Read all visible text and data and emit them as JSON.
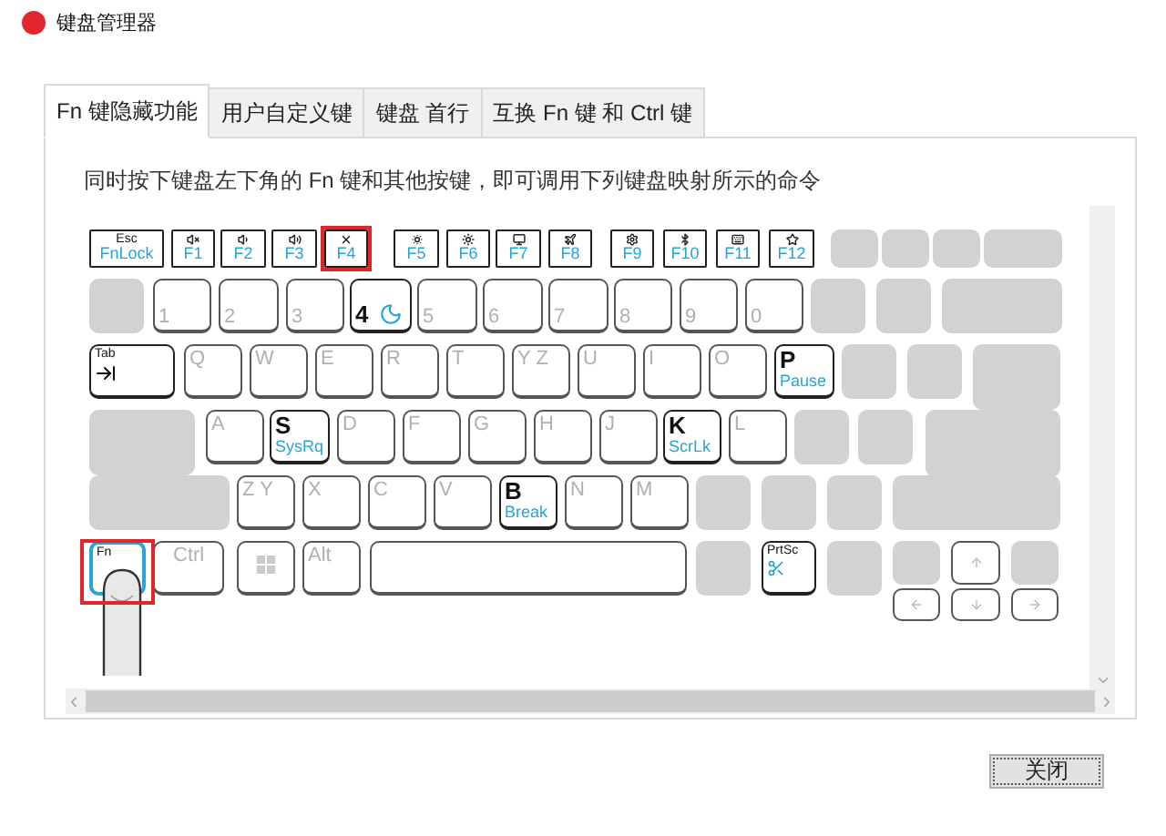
{
  "window": {
    "title": "键盘管理器"
  },
  "tabs": [
    {
      "label": "Fn 键隐藏功能",
      "selected": true
    },
    {
      "label": "用户自定义键",
      "selected": false
    },
    {
      "label": "键盘 首行",
      "selected": false
    },
    {
      "label": "互换 Fn 键 和 Ctrl 键",
      "selected": false
    }
  ],
  "instruction": "同时按下键盘左下角的 Fn 键和其他按键，即可调用下列键盘映射所示的命令",
  "keyboard": {
    "rows": [
      {
        "keys": [
          {
            "kind": "fkey",
            "label": "Esc",
            "function": "FnLock",
            "active": true,
            "highlighted": false,
            "pressed": false
          },
          {
            "kind": "fkey",
            "function": "F1",
            "active": true,
            "highlighted": false,
            "pressed": false
          },
          {
            "kind": "fkey",
            "function": "F2",
            "active": true,
            "highlighted": false,
            "pressed": false
          },
          {
            "kind": "fkey",
            "function": "F3",
            "active": true,
            "highlighted": false,
            "pressed": false
          },
          {
            "kind": "fkey",
            "function": "F4",
            "active": true,
            "highlighted": true,
            "pressed": false
          },
          {
            "kind": "fkey",
            "function": "F5",
            "active": true,
            "highlighted": false,
            "pressed": false
          },
          {
            "kind": "fkey",
            "function": "F6",
            "active": true,
            "highlighted": false,
            "pressed": false
          },
          {
            "kind": "fkey",
            "function": "F7",
            "active": true,
            "highlighted": false,
            "pressed": false
          },
          {
            "kind": "fkey",
            "function": "F8",
            "active": true,
            "highlighted": false,
            "pressed": false
          },
          {
            "kind": "fkey",
            "function": "F9",
            "active": true,
            "highlighted": false,
            "pressed": false
          },
          {
            "kind": "fkey",
            "function": "F10",
            "active": true,
            "highlighted": false,
            "pressed": false
          },
          {
            "kind": "fkey",
            "function": "F11",
            "active": true,
            "highlighted": false,
            "pressed": false
          },
          {
            "kind": "fkey",
            "function": "F12",
            "active": true,
            "highlighted": false,
            "pressed": false
          },
          {
            "kind": "blank"
          },
          {
            "kind": "blank"
          },
          {
            "kind": "blank"
          },
          {
            "kind": "blank"
          }
        ]
      },
      {
        "keys": [
          {
            "kind": "blank"
          },
          {
            "kind": "key",
            "label": "1",
            "active": false,
            "highlighted": false,
            "pressed": false
          },
          {
            "kind": "key",
            "label": "2",
            "active": false,
            "highlighted": false,
            "pressed": false
          },
          {
            "kind": "key",
            "label": "3",
            "active": false,
            "highlighted": false,
            "pressed": false
          },
          {
            "kind": "key",
            "label": "4",
            "active": true,
            "highlighted": false,
            "pressed": false
          },
          {
            "kind": "key",
            "label": "5",
            "active": false,
            "highlighted": false,
            "pressed": false
          },
          {
            "kind": "key",
            "label": "6",
            "active": false,
            "highlighted": false,
            "pressed": false
          },
          {
            "kind": "key",
            "label": "7",
            "active": false,
            "highlighted": false,
            "pressed": false
          },
          {
            "kind": "key",
            "label": "8",
            "active": false,
            "highlighted": false,
            "pressed": false
          },
          {
            "kind": "key",
            "label": "9",
            "active": false,
            "highlighted": false,
            "pressed": false
          },
          {
            "kind": "key",
            "label": "0",
            "active": false,
            "highlighted": false,
            "pressed": false
          },
          {
            "kind": "blank"
          },
          {
            "kind": "blank"
          },
          {
            "kind": "blank"
          }
        ]
      },
      {
        "keys": [
          {
            "kind": "key",
            "label": "Tab",
            "active": true,
            "highlighted": false,
            "pressed": false
          },
          {
            "kind": "key",
            "label": "Q",
            "active": false,
            "highlighted": false,
            "pressed": false
          },
          {
            "kind": "key",
            "label": "W",
            "active": false,
            "highlighted": false,
            "pressed": false
          },
          {
            "kind": "key",
            "label": "E",
            "active": false,
            "highlighted": false,
            "pressed": false
          },
          {
            "kind": "key",
            "label": "R",
            "active": false,
            "highlighted": false,
            "pressed": false
          },
          {
            "kind": "key",
            "label": "T",
            "active": false,
            "highlighted": false,
            "pressed": false
          },
          {
            "kind": "key",
            "label": "Y Z",
            "active": false,
            "highlighted": false,
            "pressed": false
          },
          {
            "kind": "key",
            "label": "U",
            "active": false,
            "highlighted": false,
            "pressed": false
          },
          {
            "kind": "key",
            "label": "I",
            "active": false,
            "highlighted": false,
            "pressed": false
          },
          {
            "kind": "key",
            "label": "O",
            "active": false,
            "highlighted": false,
            "pressed": false
          },
          {
            "kind": "key",
            "label": "P",
            "function": "Pause",
            "active": true,
            "highlighted": false,
            "pressed": false
          },
          {
            "kind": "blank"
          },
          {
            "kind": "blank"
          },
          {
            "kind": "blank"
          }
        ]
      },
      {
        "keys": [
          {
            "kind": "blank"
          },
          {
            "kind": "key",
            "label": "A",
            "active": false,
            "highlighted": false,
            "pressed": false
          },
          {
            "kind": "key",
            "label": "S",
            "function": "SysRq",
            "active": true,
            "highlighted": false,
            "pressed": false
          },
          {
            "kind": "key",
            "label": "D",
            "active": false,
            "highlighted": false,
            "pressed": false
          },
          {
            "kind": "key",
            "label": "F",
            "active": false,
            "highlighted": false,
            "pressed": false
          },
          {
            "kind": "key",
            "label": "G",
            "active": false,
            "highlighted": false,
            "pressed": false
          },
          {
            "kind": "key",
            "label": "H",
            "active": false,
            "highlighted": false,
            "pressed": false
          },
          {
            "kind": "key",
            "label": "J",
            "active": false,
            "highlighted": false,
            "pressed": false
          },
          {
            "kind": "key",
            "label": "K",
            "function": "ScrLk",
            "active": true,
            "highlighted": false,
            "pressed": false
          },
          {
            "kind": "key",
            "label": "L",
            "active": false,
            "highlighted": false,
            "pressed": false
          },
          {
            "kind": "blank"
          },
          {
            "kind": "blank"
          },
          {
            "kind": "blank"
          }
        ]
      },
      {
        "keys": [
          {
            "kind": "blank"
          },
          {
            "kind": "key",
            "label": "Z Y",
            "active": false,
            "highlighted": false,
            "pressed": false
          },
          {
            "kind": "key",
            "label": "X",
            "active": false,
            "highlighted": false,
            "pressed": false
          },
          {
            "kind": "key",
            "label": "C",
            "active": false,
            "highlighted": false,
            "pressed": false
          },
          {
            "kind": "key",
            "label": "V",
            "active": false,
            "highlighted": false,
            "pressed": false
          },
          {
            "kind": "key",
            "label": "B",
            "function": "Break",
            "active": true,
            "highlighted": false,
            "pressed": false
          },
          {
            "kind": "key",
            "label": "N",
            "active": false,
            "highlighted": false,
            "pressed": false
          },
          {
            "kind": "key",
            "label": "M",
            "active": false,
            "highlighted": false,
            "pressed": false
          },
          {
            "kind": "blank"
          },
          {
            "kind": "blank"
          },
          {
            "kind": "blank"
          },
          {
            "kind": "blank"
          }
        ]
      },
      {
        "keys": [
          {
            "kind": "key",
            "label": "Fn",
            "active": true,
            "highlighted": true,
            "pressed": true
          },
          {
            "kind": "key",
            "label": "Ctrl",
            "active": false,
            "highlighted": false,
            "pressed": false
          },
          {
            "kind": "key",
            "active": false,
            "highlighted": false,
            "pressed": false
          },
          {
            "kind": "key",
            "label": "Alt",
            "active": false,
            "highlighted": false,
            "pressed": false
          },
          {
            "kind": "key",
            "active": false,
            "highlighted": false,
            "pressed": false
          },
          {
            "kind": "blank"
          },
          {
            "kind": "key",
            "label": "PrtSc",
            "active": true,
            "highlighted": false,
            "pressed": false
          },
          {
            "kind": "blank"
          }
        ]
      }
    ],
    "arrow_keys": [
      {
        "kind": "blank"
      },
      {
        "kind": "arrow"
      },
      {
        "kind": "blank"
      },
      {
        "kind": "arrow"
      },
      {
        "kind": "arrow"
      },
      {
        "kind": "arrow"
      }
    ]
  },
  "buttons": [
    {
      "label": "关闭"
    }
  ]
}
